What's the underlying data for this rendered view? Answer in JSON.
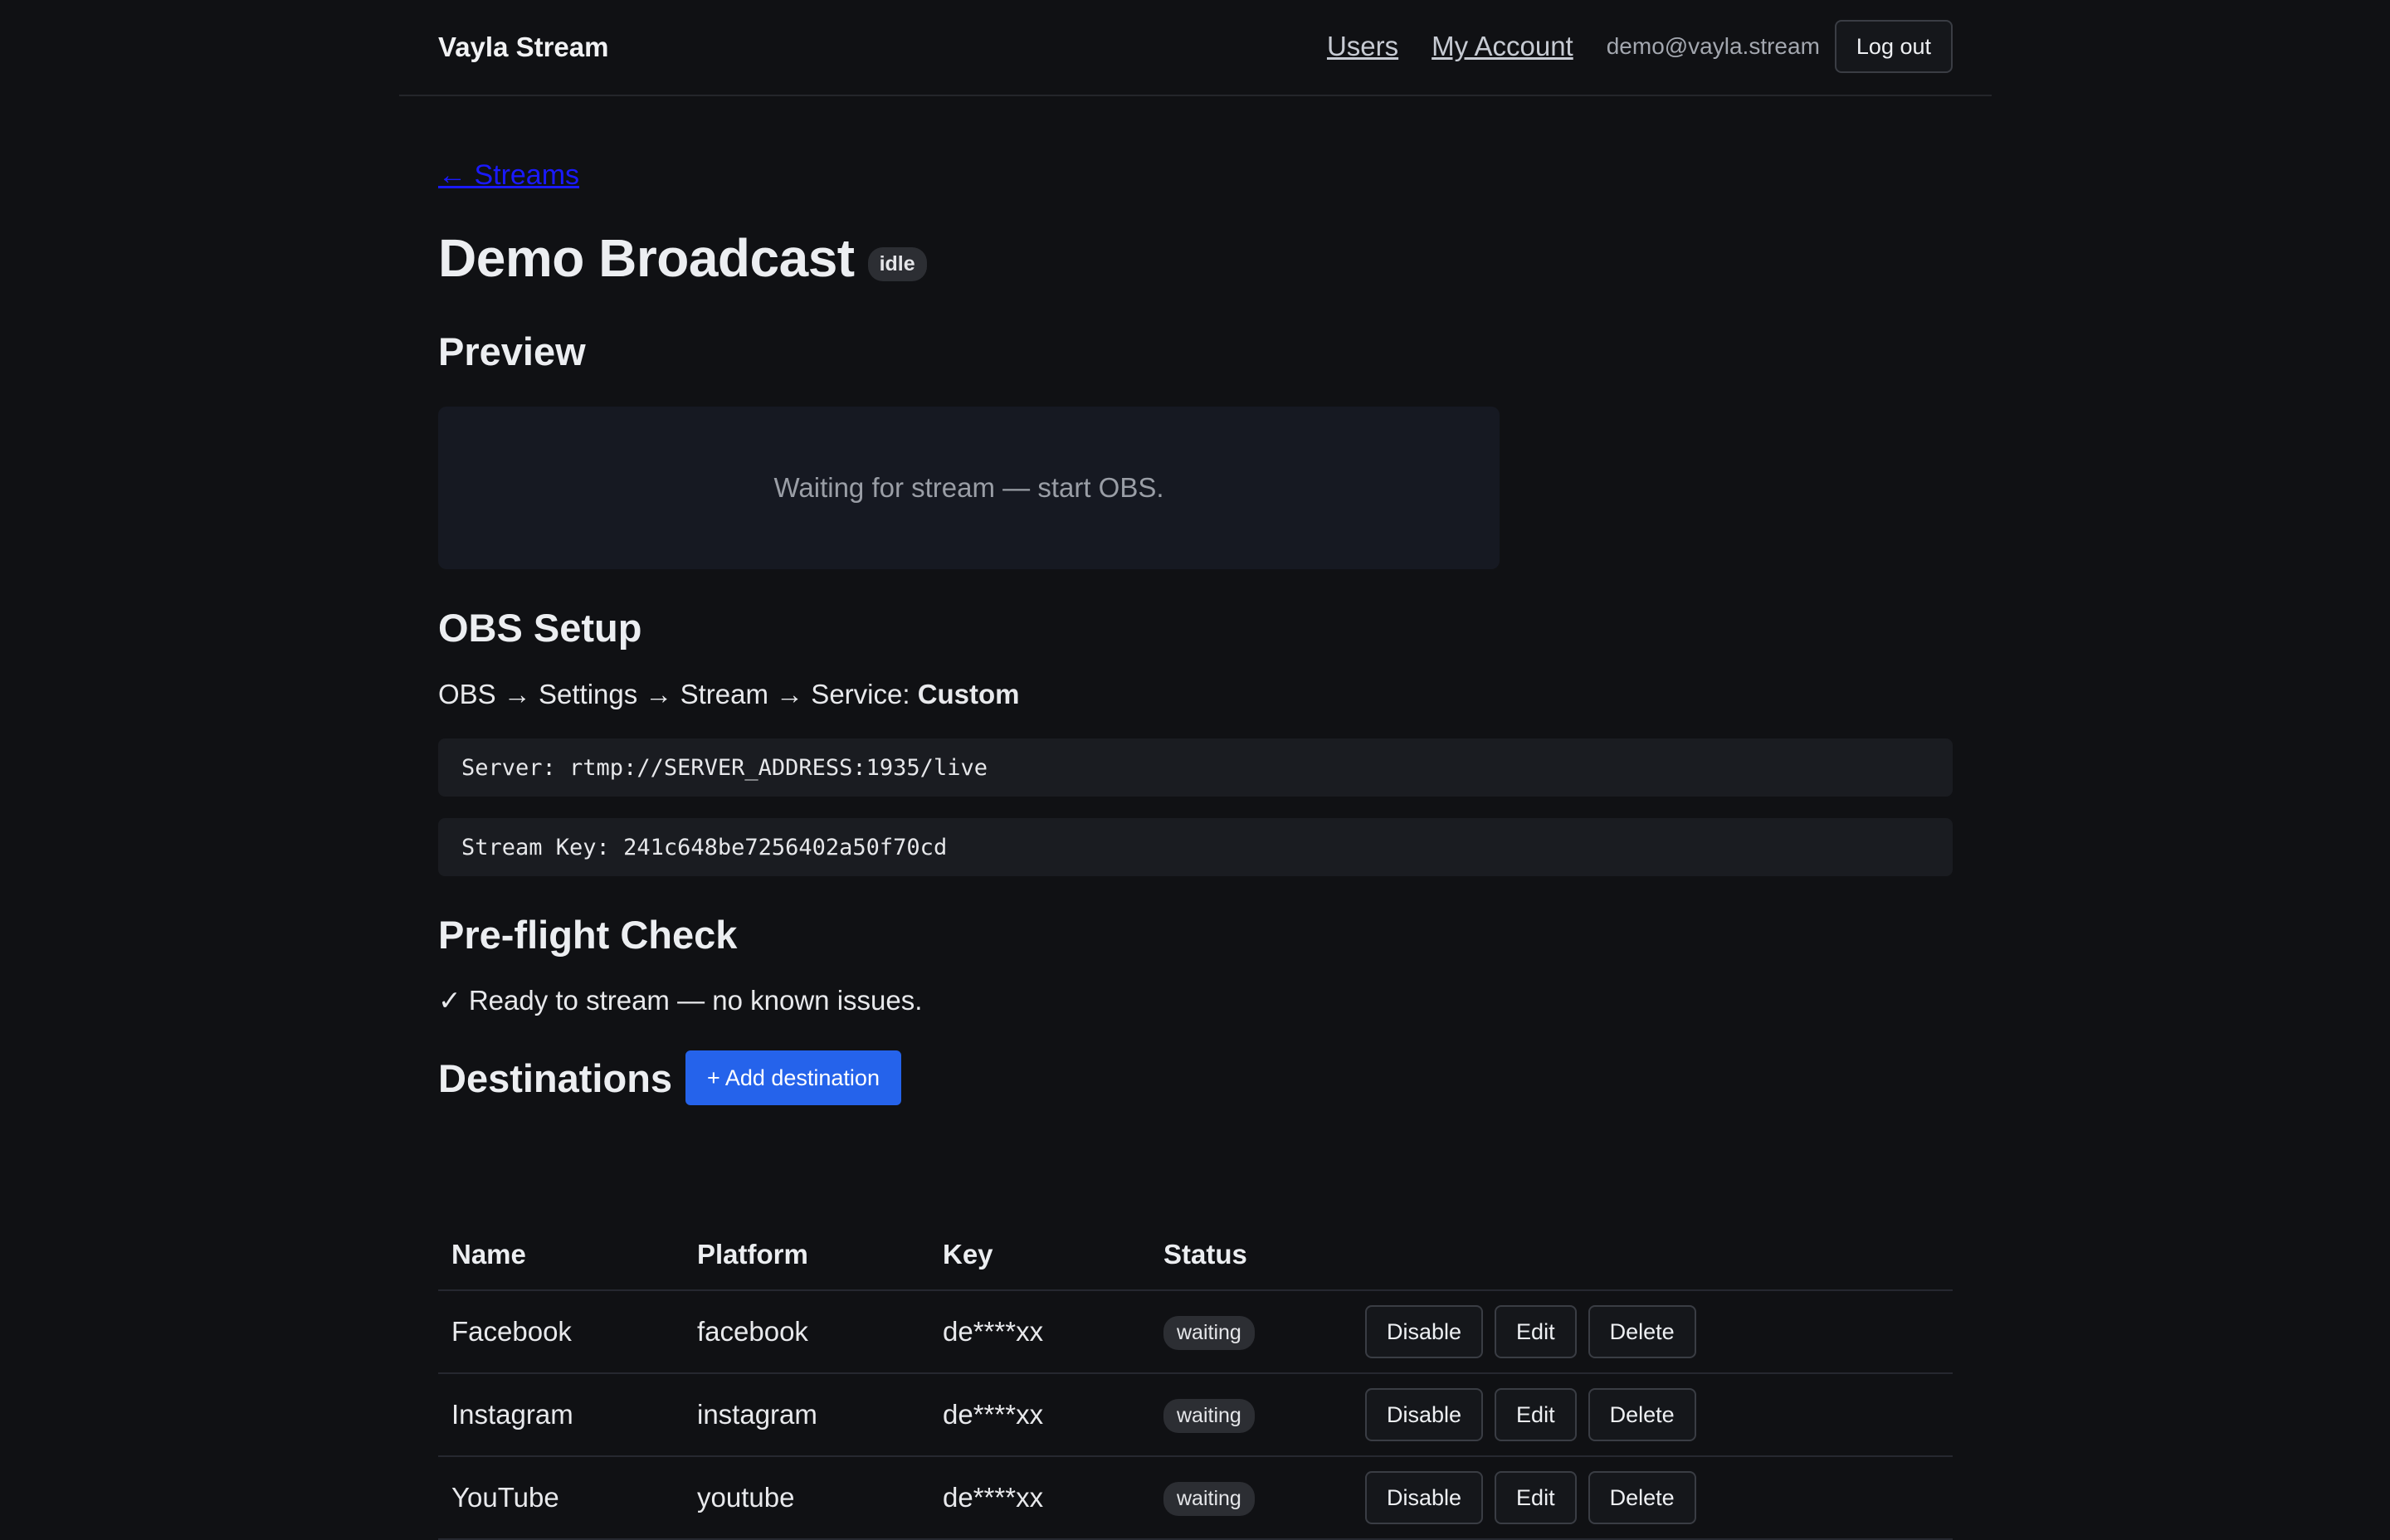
{
  "header": {
    "brand": "Vayla Stream",
    "nav_users": "Users",
    "nav_account": "My Account",
    "user_email": "demo@vayla.stream",
    "logout_label": "Log out"
  },
  "back_link": "← Streams",
  "stream": {
    "title": "Demo Broadcast",
    "status": "idle"
  },
  "preview": {
    "heading": "Preview",
    "placeholder": "Waiting for stream — start OBS."
  },
  "obs": {
    "heading": "OBS Setup",
    "path_prefix": "OBS → Settings → Stream → Service:",
    "path_service": "Custom",
    "server_line": "Server: rtmp://SERVER_ADDRESS:1935/live",
    "key_line": "Stream Key: 241c648be7256402a50f70cd"
  },
  "preflight": {
    "heading": "Pre-flight Check",
    "message": "✓ Ready to stream — no known issues."
  },
  "destinations": {
    "heading": "Destinations",
    "add_label": "+ Add destination",
    "columns": [
      "Name",
      "Platform",
      "Key",
      "Status"
    ],
    "rows": [
      {
        "name": "Facebook",
        "platform": "facebook",
        "key": "de****xx",
        "status": "waiting",
        "disable": "Disable",
        "edit": "Edit",
        "delete": "Delete"
      },
      {
        "name": "Instagram",
        "platform": "instagram",
        "key": "de****xx",
        "status": "waiting",
        "disable": "Disable",
        "edit": "Edit",
        "delete": "Delete"
      },
      {
        "name": "YouTube",
        "platform": "youtube",
        "key": "de****xx",
        "status": "waiting",
        "disable": "Disable",
        "edit": "Edit",
        "delete": "Delete"
      }
    ]
  },
  "colors": {
    "background": "#101114",
    "accent": "#2563eb",
    "back_link": "#1a1aff"
  }
}
